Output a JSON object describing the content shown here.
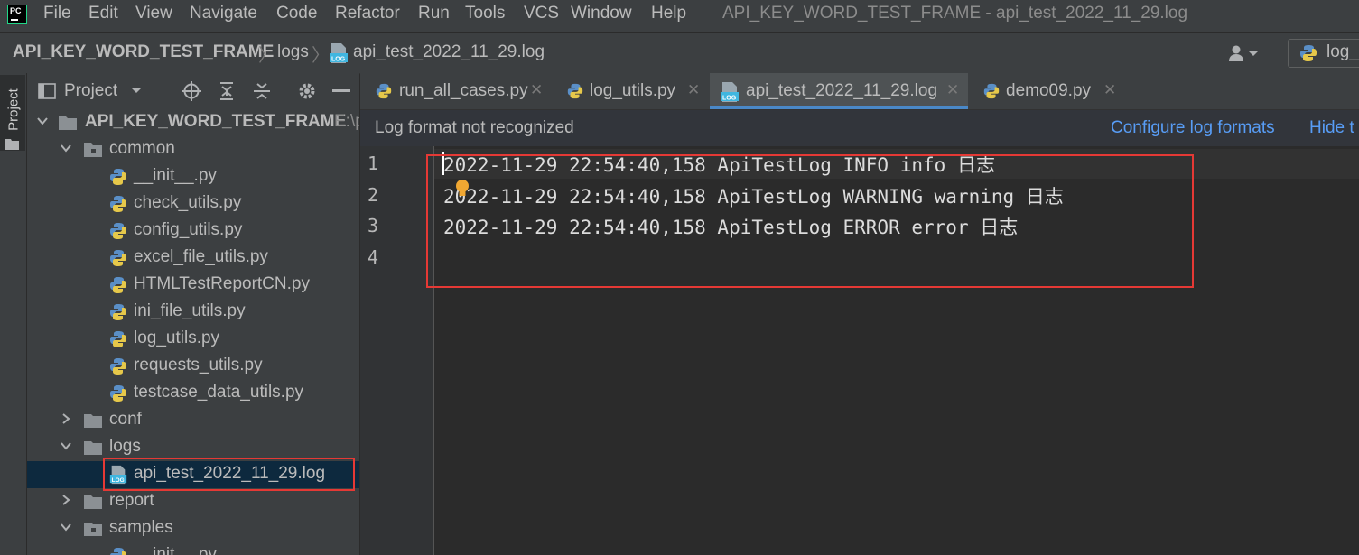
{
  "menu": {
    "logo_text": "PC",
    "items": [
      "File",
      "Edit",
      "View",
      "Navigate",
      "Code",
      "Refactor",
      "Run",
      "Tools",
      "VCS",
      "Window",
      "Help"
    ],
    "window_title": "API_KEY_WORD_TEST_FRAME - api_test_2022_11_29.log"
  },
  "breadcrumb": {
    "project": "API_KEY_WORD_TEST_FRAME",
    "folder": "logs",
    "file": "api_test_2022_11_29.log",
    "run_config": "log_"
  },
  "tool_strip": {
    "project_label": "Project"
  },
  "project_panel": {
    "title": "Project",
    "root_name": "API_KEY_WORD_TEST_FRAME",
    "root_path": "E:\\p",
    "tree": [
      {
        "label": "common",
        "kind": "folder",
        "expanded": true
      },
      {
        "label": "__init__.py",
        "kind": "python"
      },
      {
        "label": "check_utils.py",
        "kind": "python"
      },
      {
        "label": "config_utils.py",
        "kind": "python"
      },
      {
        "label": "excel_file_utils.py",
        "kind": "python"
      },
      {
        "label": "HTMLTestReportCN.py",
        "kind": "python"
      },
      {
        "label": "ini_file_utils.py",
        "kind": "python"
      },
      {
        "label": "log_utils.py",
        "kind": "python"
      },
      {
        "label": "requests_utils.py",
        "kind": "python"
      },
      {
        "label": "testcase_data_utils.py",
        "kind": "python"
      },
      {
        "label": "conf",
        "kind": "folder",
        "expanded": false
      },
      {
        "label": "logs",
        "kind": "folder",
        "expanded": true
      },
      {
        "label": "api_test_2022_11_29.log",
        "kind": "log",
        "selected": true
      },
      {
        "label": "report",
        "kind": "folder",
        "expanded": false
      },
      {
        "label": "samples",
        "kind": "folder",
        "expanded": true
      },
      {
        "label": "__init__.py",
        "kind": "python"
      }
    ]
  },
  "tabs": [
    {
      "label": "run_all_cases.py",
      "icon": "python-file-icon",
      "active": false
    },
    {
      "label": "log_utils.py",
      "icon": "python-file-icon",
      "active": false
    },
    {
      "label": "api_test_2022_11_29.log",
      "icon": "log-file-icon",
      "active": true
    },
    {
      "label": "demo09.py",
      "icon": "python-file-icon",
      "active": false
    }
  ],
  "notification": {
    "message": "Log format not recognized",
    "configure_link": "Configure log formats",
    "hide_link": "Hide t"
  },
  "editor": {
    "line_numbers": [
      "1",
      "2",
      "3",
      "4"
    ],
    "lines": [
      "2022-11-29 22:54:40,158 ApiTestLog INFO info 日志",
      "2022-11-29 22:54:40,158 ApiTestLog WARNING warning 日志",
      "2022-11-29 22:54:40,158 ApiTestLog ERROR error 日志",
      ""
    ]
  },
  "colors": {
    "accent": "#4a88c7",
    "link": "#589df6",
    "annotation_red": "#e53935",
    "selection": "#0d293e"
  }
}
